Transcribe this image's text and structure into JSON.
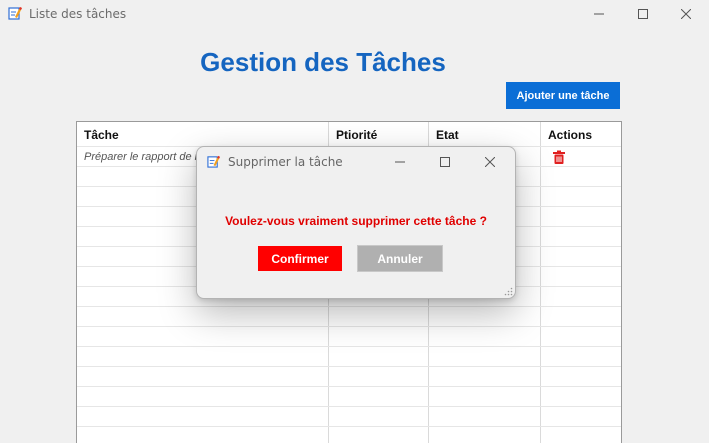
{
  "window": {
    "title": "Liste des tâches",
    "icons": {
      "app": "app-icon",
      "minimize": "minimize-icon",
      "maximize": "maximize-icon",
      "close": "close-icon"
    }
  },
  "main": {
    "heading": "Gestion des Tâches",
    "add_button": "Ajouter une tâche",
    "accent_color": "#0b6ed6",
    "heading_color": "#1565c0"
  },
  "table": {
    "columns": [
      "Tâche",
      "Ptiorité",
      "Etat",
      "Actions"
    ],
    "rows": [
      {
        "task": "Préparer le rapport de re",
        "action_icon": "trash-icon"
      }
    ]
  },
  "dialog": {
    "title": "Supprimer la tâche",
    "message": "Voulez-vous vraiment supprimer cette tâche ?",
    "confirm": "Confirmer",
    "cancel": "Annuler",
    "confirm_color": "#ff0000",
    "message_color": "#e00000"
  }
}
